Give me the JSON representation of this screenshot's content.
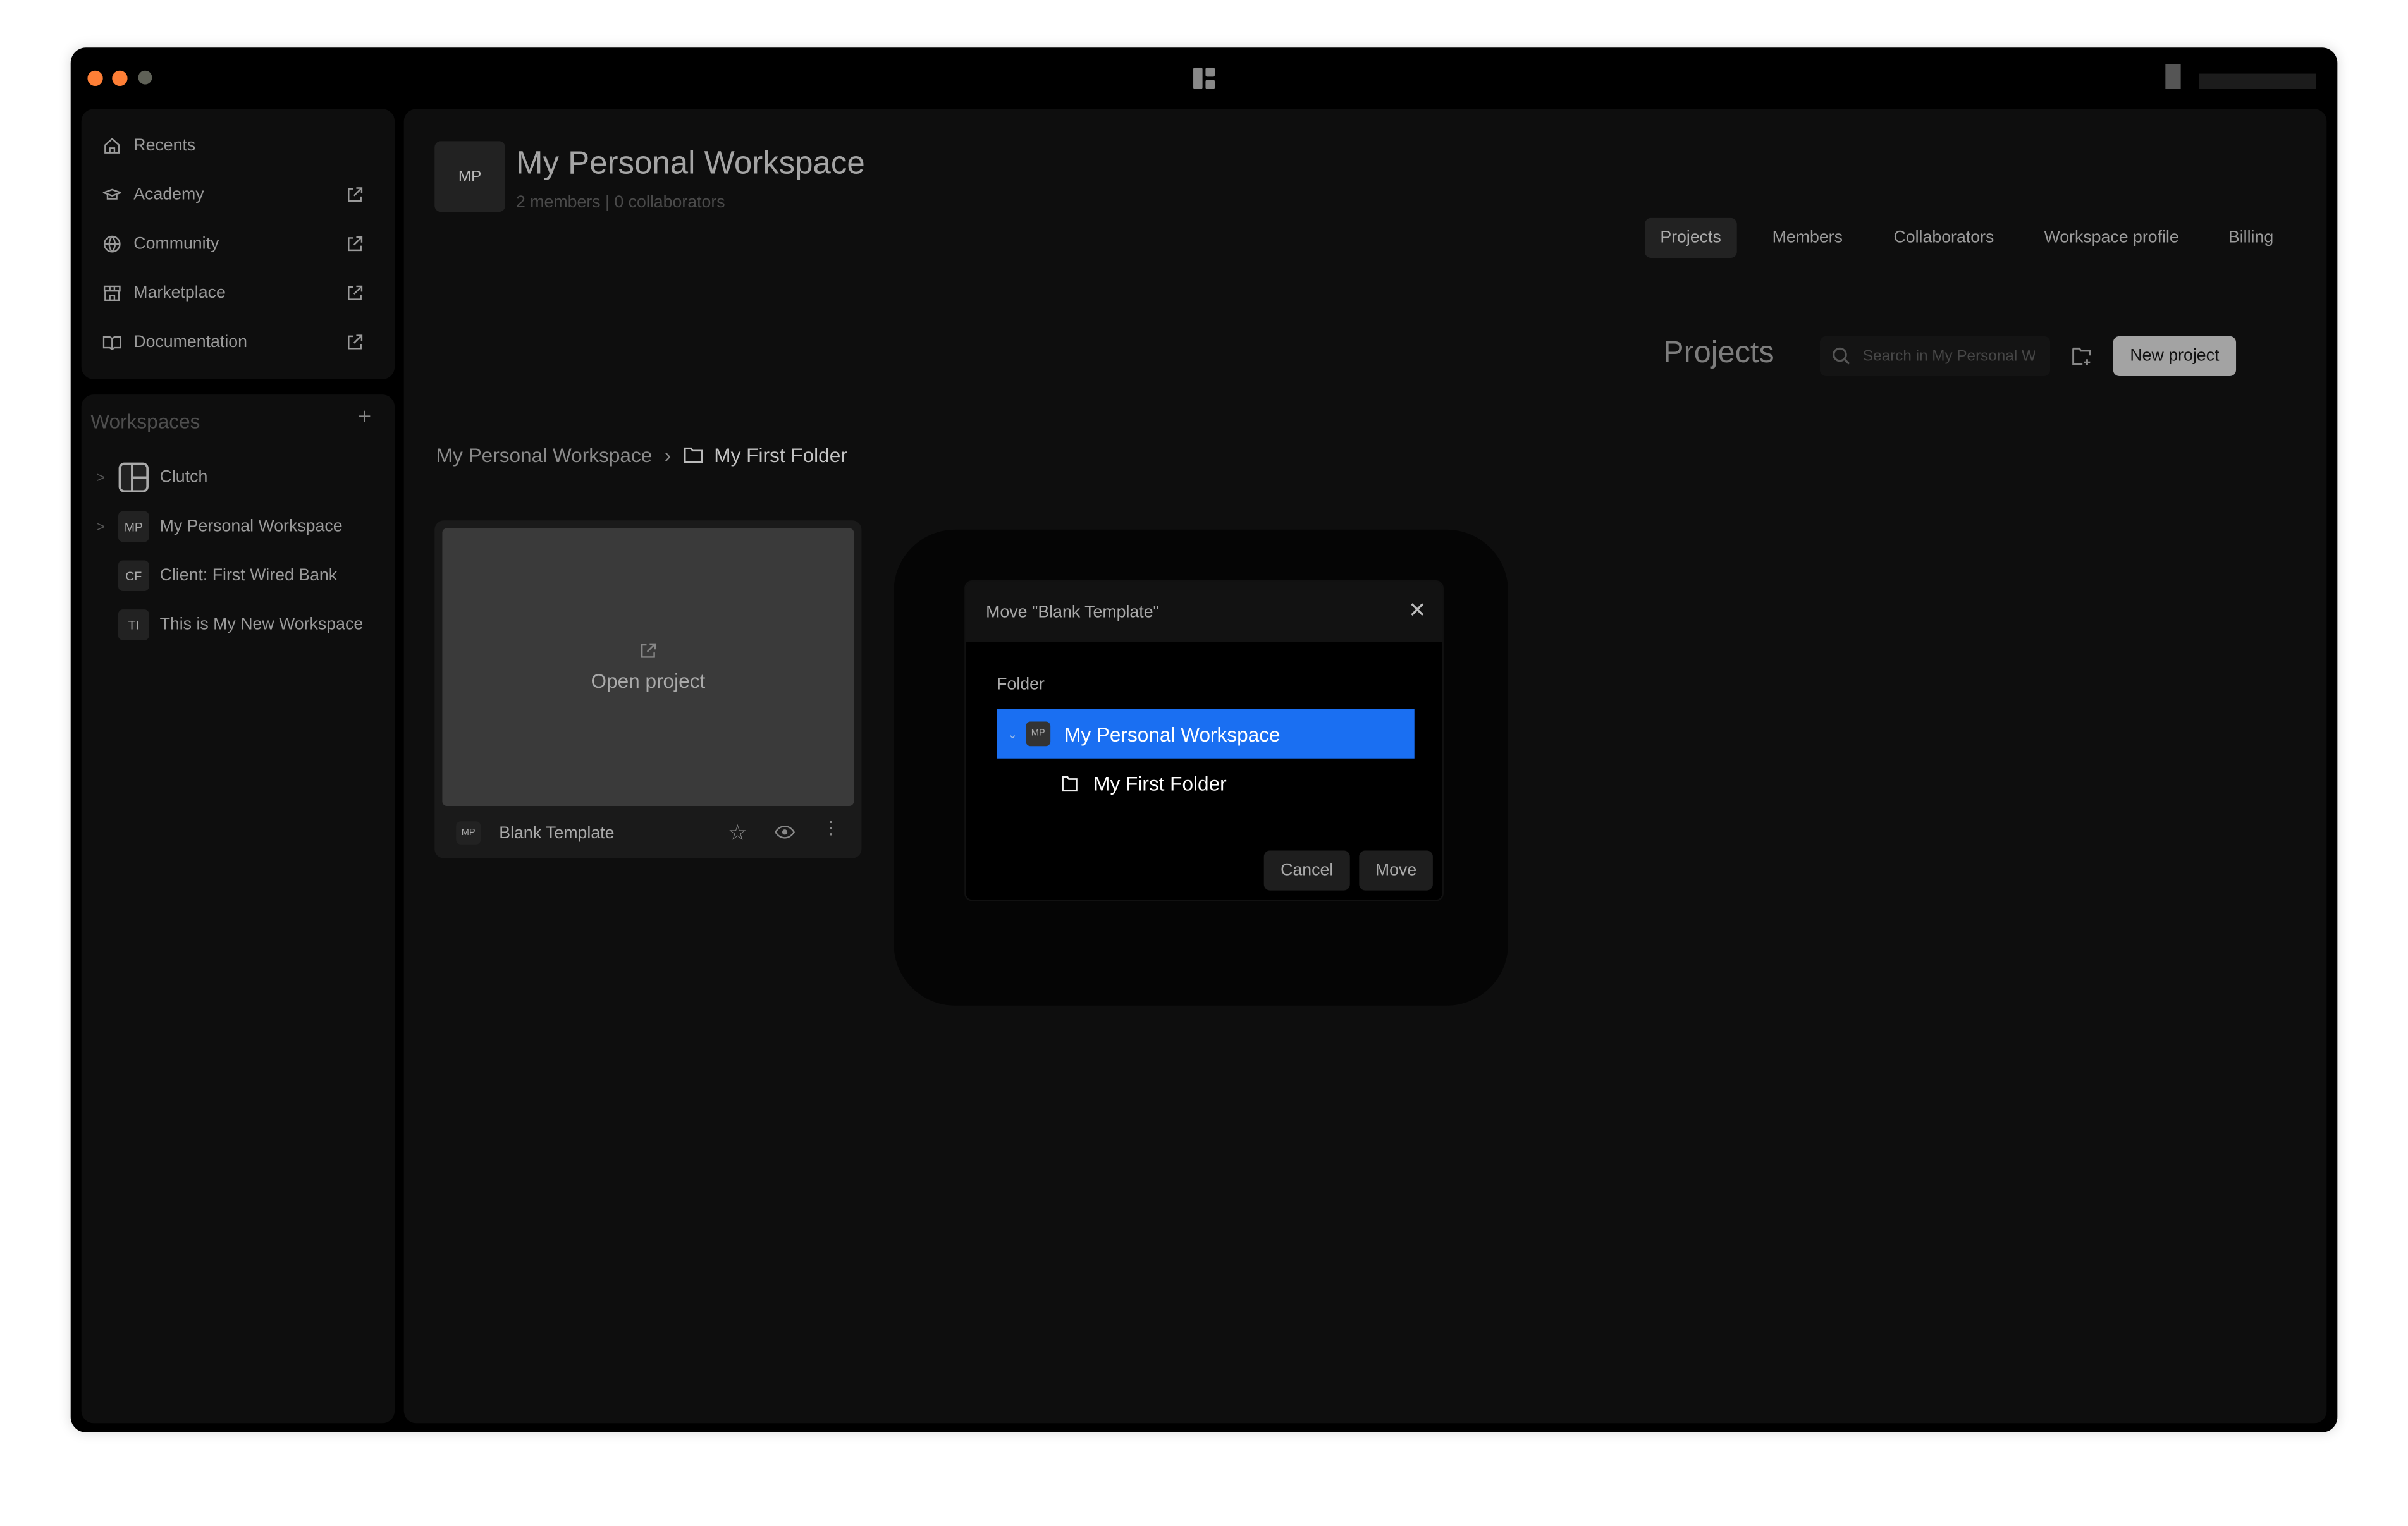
{
  "window": {
    "controls": [
      "close",
      "minimize",
      "zoom"
    ],
    "colors": {
      "close": "#fe7f36",
      "minimize": "#fe7f36",
      "zoom": "#5f6157"
    }
  },
  "sidebar": {
    "items": [
      {
        "label": "Recents",
        "icon": "home-icon",
        "external": false
      },
      {
        "label": "Academy",
        "icon": "graduation-cap-icon",
        "external": true
      },
      {
        "label": "Community",
        "icon": "globe-icon",
        "external": true
      },
      {
        "label": "Marketplace",
        "icon": "store-icon",
        "external": true
      },
      {
        "label": "Documentation",
        "icon": "book-icon",
        "external": true
      }
    ],
    "workspaces_title": "Workspaces",
    "workspaces": [
      {
        "badge": "",
        "label": "Clutch",
        "expandable": true,
        "logo": true
      },
      {
        "badge": "MP",
        "label": "My Personal Workspace",
        "expandable": true
      },
      {
        "badge": "CF",
        "label": "Client: First Wired Bank",
        "expandable": false
      },
      {
        "badge": "TI",
        "label": "This is My New Workspace",
        "expandable": false
      }
    ]
  },
  "header": {
    "badge": "MP",
    "title": "My Personal Workspace",
    "subtitle": "2 members | 0 collaborators",
    "tabs": [
      {
        "label": "Projects",
        "active": true
      },
      {
        "label": "Members"
      },
      {
        "label": "Collaborators"
      },
      {
        "label": "Workspace profile"
      },
      {
        "label": "Billing"
      }
    ]
  },
  "projects": {
    "title": "Projects",
    "search_placeholder": "Search in My Personal W",
    "new_project": "New project"
  },
  "breadcrumb": {
    "root": "My Personal Workspace",
    "current": "My First Folder"
  },
  "card": {
    "hover_label": "Open project",
    "badge": "MP",
    "name": "Blank Template"
  },
  "modal": {
    "title": "Move \"Blank Template\"",
    "folder_label": "Folder",
    "tree": [
      {
        "badge": "MP",
        "label": "My Personal Workspace",
        "selected": true
      },
      {
        "label": "My First Folder",
        "selected": false
      }
    ],
    "cancel": "Cancel",
    "move": "Move",
    "accent": "#1a6ff2"
  }
}
